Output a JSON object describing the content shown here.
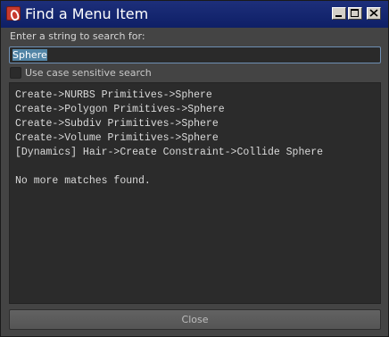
{
  "window": {
    "title": "Find a Menu Item"
  },
  "search": {
    "label": "Enter a string to search for:",
    "value": "Sphere"
  },
  "case_sensitive": {
    "label": "Use case sensitive search",
    "checked": false
  },
  "results": {
    "items": [
      "Create->NURBS Primitives->Sphere",
      "Create->Polygon Primitives->Sphere",
      "Create->Subdiv Primitives->Sphere",
      "Create->Volume Primitives->Sphere",
      "[Dynamics] Hair->Create Constraint->Collide Sphere"
    ],
    "footer": "No more matches found."
  },
  "buttons": {
    "close_label": "Close"
  },
  "icons": {
    "app": "maya-app-icon",
    "minimize": "minimize-icon",
    "maximize": "maximize-icon",
    "close": "close-icon"
  },
  "colors": {
    "titlebar": "#0e1f66",
    "background": "#444444",
    "selection": "#5285a6"
  }
}
